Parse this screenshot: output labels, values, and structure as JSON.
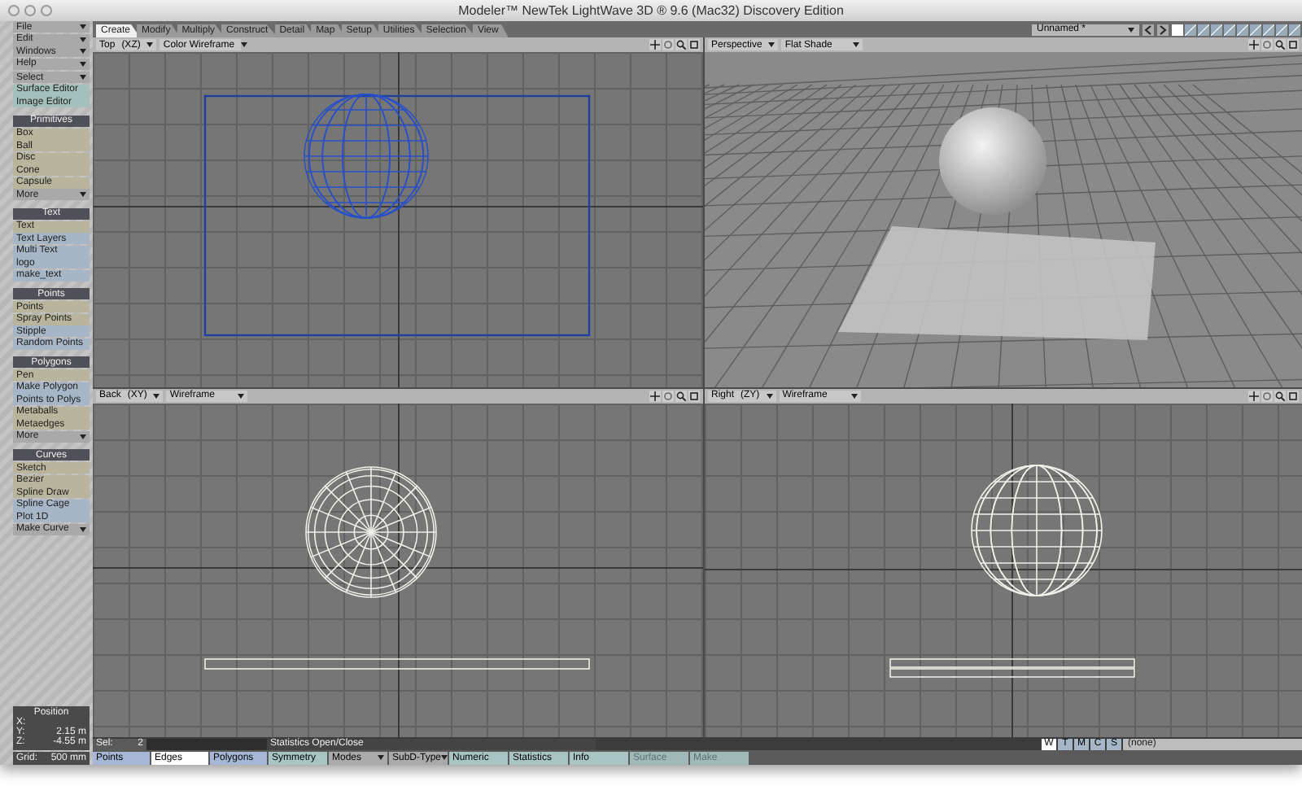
{
  "window": {
    "title": "Modeler™ NewTek LightWave 3D ® 9.6  (Mac32) Discovery Edition"
  },
  "menus": [
    {
      "label": "File"
    },
    {
      "label": "Edit"
    },
    {
      "label": "Windows"
    },
    {
      "label": "Help"
    }
  ],
  "sidebar": [
    {
      "items": [
        {
          "label": "Select",
          "kind": "menu"
        },
        {
          "label": "Surface Editor",
          "kind": "editor"
        },
        {
          "label": "Image Editor",
          "kind": "editor"
        }
      ]
    },
    {
      "title": "Primitives",
      "items": [
        {
          "label": "Box",
          "kind": "create"
        },
        {
          "label": "Ball",
          "kind": "create"
        },
        {
          "label": "Disc",
          "kind": "create"
        },
        {
          "label": "Cone",
          "kind": "create"
        },
        {
          "label": "Capsule",
          "kind": "create"
        },
        {
          "label": "More",
          "kind": "menu"
        }
      ]
    },
    {
      "title": "Text",
      "items": [
        {
          "label": "Text",
          "kind": "create"
        },
        {
          "label": "Text Layers",
          "kind": "command"
        },
        {
          "label": "Multi Text",
          "kind": "command"
        },
        {
          "label": "logo",
          "kind": "command"
        },
        {
          "label": "make_text",
          "kind": "command"
        }
      ]
    },
    {
      "title": "Points",
      "items": [
        {
          "label": "Points",
          "kind": "create"
        },
        {
          "label": "Spray Points",
          "kind": "create"
        },
        {
          "label": "Stipple",
          "kind": "command"
        },
        {
          "label": "Random Points",
          "kind": "command"
        }
      ]
    },
    {
      "title": "Polygons",
      "items": [
        {
          "label": "Pen",
          "kind": "create"
        },
        {
          "label": "Make Polygon",
          "kind": "command"
        },
        {
          "label": "Points to Polys",
          "kind": "command"
        },
        {
          "label": "Metaballs",
          "kind": "create"
        },
        {
          "label": "Metaedges",
          "kind": "create"
        },
        {
          "label": "More",
          "kind": "menu"
        }
      ]
    },
    {
      "title": "Curves",
      "items": [
        {
          "label": "Sketch",
          "kind": "create"
        },
        {
          "label": "Bezier",
          "kind": "create"
        },
        {
          "label": "Spline Draw",
          "kind": "create"
        },
        {
          "label": "Spline Cage",
          "kind": "command"
        },
        {
          "label": "Plot 1D",
          "kind": "command"
        },
        {
          "label": "Make Curve",
          "kind": "menu"
        }
      ]
    }
  ],
  "position": {
    "title": "Position",
    "rows": [
      {
        "axis": "X:"
      },
      {
        "axis": "Y:",
        "value": "2.15 m"
      },
      {
        "axis": "Z:",
        "value": "-4.55 m"
      }
    ]
  },
  "grid": {
    "label": "Grid:",
    "value": "500 mm"
  },
  "tabs": [
    {
      "label": "Create",
      "selected": true
    },
    {
      "label": "Modify",
      "selected": false
    },
    {
      "label": "Multiply",
      "selected": false
    },
    {
      "label": "Construct",
      "selected": false
    },
    {
      "label": "Detail",
      "selected": false
    },
    {
      "label": "Map",
      "selected": false
    },
    {
      "label": "Setup",
      "selected": false
    },
    {
      "label": "Utilities",
      "selected": false
    },
    {
      "label": "Selection",
      "selected": false
    },
    {
      "label": "View",
      "selected": false
    }
  ],
  "object_menu": {
    "value": "Unnamed *"
  },
  "layers": [
    {
      "selected": true
    },
    {
      "selected": false
    },
    {
      "selected": false
    },
    {
      "selected": false
    },
    {
      "selected": false
    },
    {
      "selected": false
    },
    {
      "selected": false
    },
    {
      "selected": false
    },
    {
      "selected": false
    },
    {
      "selected": false
    }
  ],
  "viewports": [
    {
      "view": "Top",
      "axes": "(XZ)",
      "mode": "Color Wireframe",
      "kind": "top"
    },
    {
      "view": "Perspective",
      "mode": "Flat Shade",
      "kind": "perspective"
    },
    {
      "view": "Back",
      "axes": "(XY)",
      "mode": "Wireframe",
      "kind": "back"
    },
    {
      "view": "Right",
      "axes": "(ZY)",
      "mode": "Wireframe",
      "kind": "right"
    }
  ],
  "status": {
    "sel_label": "Sel:",
    "sel_count": "2",
    "statistics": "Statistics Open/Close",
    "layer_modes": [
      {
        "label": "W",
        "selected": true
      },
      {
        "label": "T",
        "selected": false
      },
      {
        "label": "M",
        "selected": false
      },
      {
        "label": "C",
        "selected": false
      },
      {
        "label": "S",
        "selected": false
      }
    ],
    "surface": "(none)"
  },
  "selection_modes": [
    {
      "label": "Points",
      "selected": false
    },
    {
      "label": "Edges",
      "selected": true
    },
    {
      "label": "Polygons",
      "selected": false
    }
  ],
  "toolbar": [
    {
      "label": "Symmetry",
      "kind": "toggle",
      "disabled": false
    },
    {
      "label": "Modes",
      "kind": "menu",
      "disabled": false
    },
    {
      "label": "SubD-Type",
      "kind": "menu",
      "disabled": false
    },
    {
      "label": "Numeric",
      "kind": "toggle",
      "disabled": false
    },
    {
      "label": "Statistics",
      "kind": "toggle",
      "disabled": false
    },
    {
      "label": "Info",
      "kind": "toggle",
      "disabled": false
    },
    {
      "label": "Surface",
      "kind": "toggle",
      "disabled": true
    },
    {
      "label": "Make",
      "kind": "toggle",
      "disabled": true
    }
  ]
}
